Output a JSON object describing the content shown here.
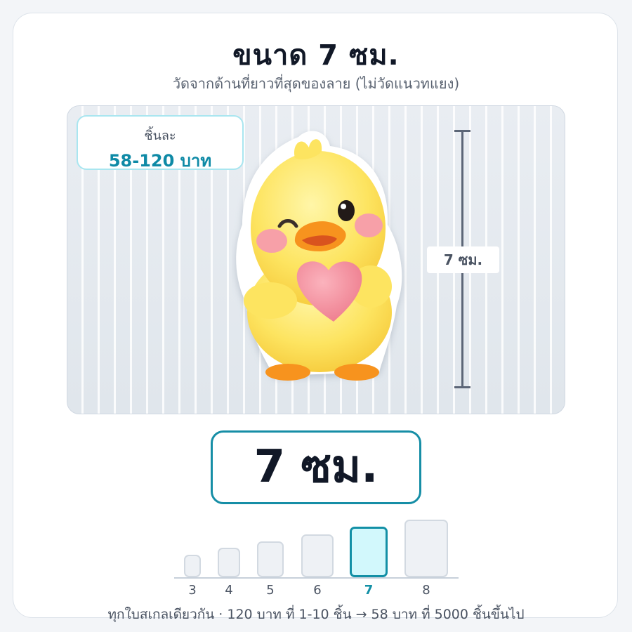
{
  "header": {
    "title": "ขนาด 7 ซม.",
    "subtitle": "วัดจากด้านที่ยาวที่สุดของลาย (ไม่วัดแนวทแยง)"
  },
  "price_badge": {
    "label": "ชิ้นละ",
    "value": "58-120 บาท"
  },
  "sticker": {
    "description_icon": "yellow-duck-holding-heart-sticker",
    "colors": {
      "body": "#fde460",
      "beak": "#f7931e",
      "heart": "#f48a9a",
      "blush": "#f7a0a8"
    }
  },
  "measurement": {
    "label": "7 ซม."
  },
  "selected_size": {
    "label": "7 ซม."
  },
  "scale": {
    "sizes": [
      "3",
      "4",
      "5",
      "6",
      "7",
      "8"
    ],
    "selected": "7"
  },
  "footer": {
    "text": "ทุกใบสเกลเดียวกัน · 120 บาท ที่ 1-10 ชิ้น → 58 บาท ที่ 5000 ชิ้นขึ้นไป"
  },
  "colors": {
    "accent": "#1390a6",
    "price": "#0e8aa6",
    "title": "#111827"
  }
}
